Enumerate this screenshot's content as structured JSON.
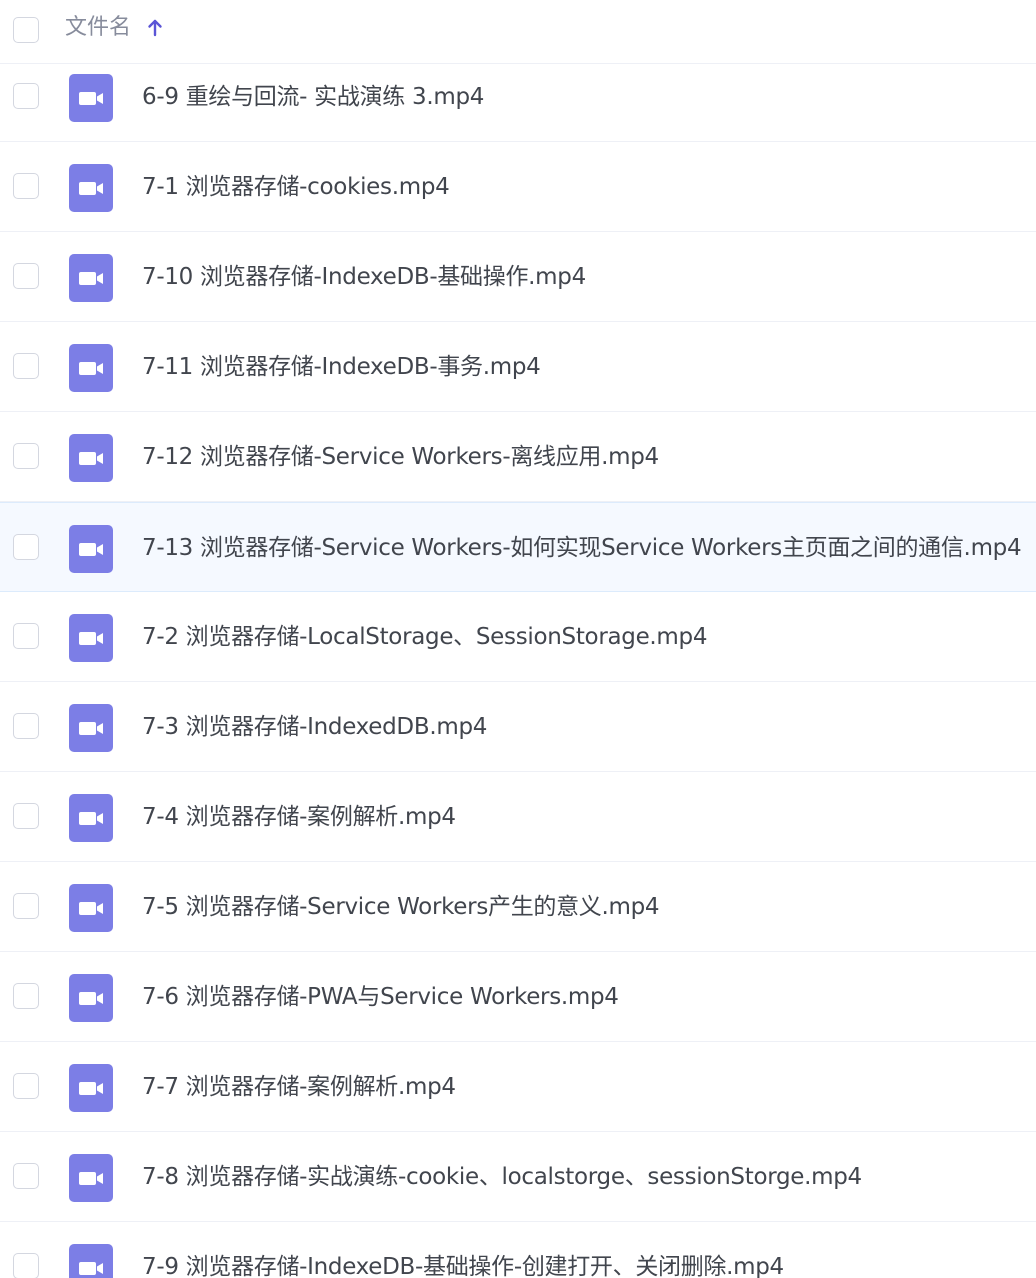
{
  "header": {
    "column_label": "文件名",
    "sort_icon": "arrow-up-icon",
    "accent_color": "#5b55d6"
  },
  "colors": {
    "video_icon": "#7c7ee6",
    "row_highlight": "#f5f9ff",
    "text": "#41454d"
  },
  "files": [
    {
      "name": "6-9 重绘与回流- 实战演练 3.mp4",
      "icon": "video-file-icon",
      "highlighted": false
    },
    {
      "name": "7-1 浏览器存储-cookies.mp4",
      "icon": "video-file-icon",
      "highlighted": false
    },
    {
      "name": "7-10 浏览器存储-IndexeDB-基础操作.mp4",
      "icon": "video-file-icon",
      "highlighted": false
    },
    {
      "name": "7-11 浏览器存储-IndexeDB-事务.mp4",
      "icon": "video-file-icon",
      "highlighted": false
    },
    {
      "name": "7-12 浏览器存储-Service Workers-离线应用.mp4",
      "icon": "video-file-icon",
      "highlighted": false
    },
    {
      "name": "7-13 浏览器存储-Service Workers-如何实现Service Workers主页面之间的通信.mp4",
      "icon": "video-file-icon",
      "highlighted": true
    },
    {
      "name": "7-2 浏览器存储-LocalStorage、SessionStorage.mp4",
      "icon": "video-file-icon",
      "highlighted": false
    },
    {
      "name": "7-3 浏览器存储-IndexedDB.mp4",
      "icon": "video-file-icon",
      "highlighted": false
    },
    {
      "name": "7-4 浏览器存储-案例解析.mp4",
      "icon": "video-file-icon",
      "highlighted": false
    },
    {
      "name": "7-5 浏览器存储-Service Workers产生的意义.mp4",
      "icon": "video-file-icon",
      "highlighted": false
    },
    {
      "name": "7-6 浏览器存储-PWA与Service Workers.mp4",
      "icon": "video-file-icon",
      "highlighted": false
    },
    {
      "name": "7-7 浏览器存储-案例解析.mp4",
      "icon": "video-file-icon",
      "highlighted": false
    },
    {
      "name": "7-8 浏览器存储-实战演练-cookie、localstorge、sessionStorge.mp4",
      "icon": "video-file-icon",
      "highlighted": false
    },
    {
      "name": "7-9 浏览器存储-IndexeDB-基础操作-创建打开、关闭删除.mp4",
      "icon": "video-file-icon",
      "highlighted": false
    }
  ]
}
